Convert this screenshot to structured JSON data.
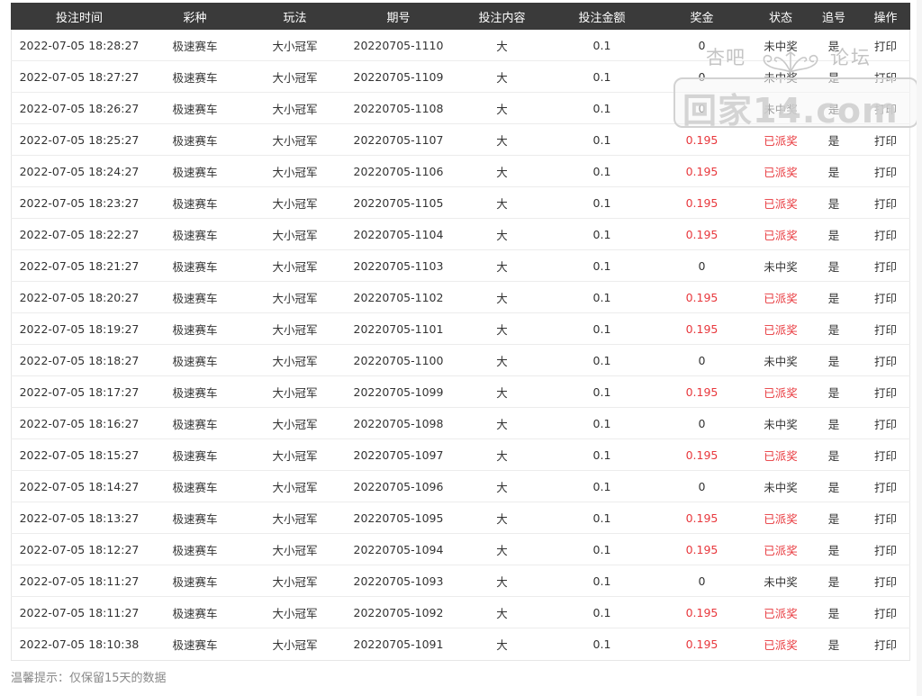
{
  "table": {
    "columns": [
      "投注时间",
      "彩种",
      "玩法",
      "期号",
      "投注内容",
      "投注金额",
      "奖金",
      "状态",
      "追号",
      "操作"
    ],
    "rows": [
      {
        "time": "2022-07-05 18:28:27",
        "lottery": "极速赛车",
        "play": "大小冠军",
        "period": "20220705-1110",
        "content": "大",
        "amount": "0.1",
        "prize": "0",
        "status": "未中奖",
        "chase": "是",
        "action": "打印",
        "won": false
      },
      {
        "time": "2022-07-05 18:27:27",
        "lottery": "极速赛车",
        "play": "大小冠军",
        "period": "20220705-1109",
        "content": "大",
        "amount": "0.1",
        "prize": "0",
        "status": "未中奖",
        "chase": "是",
        "action": "打印",
        "won": false
      },
      {
        "time": "2022-07-05 18:26:27",
        "lottery": "极速赛车",
        "play": "大小冠军",
        "period": "20220705-1108",
        "content": "大",
        "amount": "0.1",
        "prize": "0",
        "status": "未中奖",
        "chase": "是",
        "action": "打印",
        "won": false
      },
      {
        "time": "2022-07-05 18:25:27",
        "lottery": "极速赛车",
        "play": "大小冠军",
        "period": "20220705-1107",
        "content": "大",
        "amount": "0.1",
        "prize": "0.195",
        "status": "已派奖",
        "chase": "是",
        "action": "打印",
        "won": true
      },
      {
        "time": "2022-07-05 18:24:27",
        "lottery": "极速赛车",
        "play": "大小冠军",
        "period": "20220705-1106",
        "content": "大",
        "amount": "0.1",
        "prize": "0.195",
        "status": "已派奖",
        "chase": "是",
        "action": "打印",
        "won": true
      },
      {
        "time": "2022-07-05 18:23:27",
        "lottery": "极速赛车",
        "play": "大小冠军",
        "period": "20220705-1105",
        "content": "大",
        "amount": "0.1",
        "prize": "0.195",
        "status": "已派奖",
        "chase": "是",
        "action": "打印",
        "won": true
      },
      {
        "time": "2022-07-05 18:22:27",
        "lottery": "极速赛车",
        "play": "大小冠军",
        "period": "20220705-1104",
        "content": "大",
        "amount": "0.1",
        "prize": "0.195",
        "status": "已派奖",
        "chase": "是",
        "action": "打印",
        "won": true
      },
      {
        "time": "2022-07-05 18:21:27",
        "lottery": "极速赛车",
        "play": "大小冠军",
        "period": "20220705-1103",
        "content": "大",
        "amount": "0.1",
        "prize": "0",
        "status": "未中奖",
        "chase": "是",
        "action": "打印",
        "won": false
      },
      {
        "time": "2022-07-05 18:20:27",
        "lottery": "极速赛车",
        "play": "大小冠军",
        "period": "20220705-1102",
        "content": "大",
        "amount": "0.1",
        "prize": "0.195",
        "status": "已派奖",
        "chase": "是",
        "action": "打印",
        "won": true
      },
      {
        "time": "2022-07-05 18:19:27",
        "lottery": "极速赛车",
        "play": "大小冠军",
        "period": "20220705-1101",
        "content": "大",
        "amount": "0.1",
        "prize": "0.195",
        "status": "已派奖",
        "chase": "是",
        "action": "打印",
        "won": true
      },
      {
        "time": "2022-07-05 18:18:27",
        "lottery": "极速赛车",
        "play": "大小冠军",
        "period": "20220705-1100",
        "content": "大",
        "amount": "0.1",
        "prize": "0",
        "status": "未中奖",
        "chase": "是",
        "action": "打印",
        "won": false
      },
      {
        "time": "2022-07-05 18:17:27",
        "lottery": "极速赛车",
        "play": "大小冠军",
        "period": "20220705-1099",
        "content": "大",
        "amount": "0.1",
        "prize": "0.195",
        "status": "已派奖",
        "chase": "是",
        "action": "打印",
        "won": true
      },
      {
        "time": "2022-07-05 18:16:27",
        "lottery": "极速赛车",
        "play": "大小冠军",
        "period": "20220705-1098",
        "content": "大",
        "amount": "0.1",
        "prize": "0",
        "status": "未中奖",
        "chase": "是",
        "action": "打印",
        "won": false
      },
      {
        "time": "2022-07-05 18:15:27",
        "lottery": "极速赛车",
        "play": "大小冠军",
        "period": "20220705-1097",
        "content": "大",
        "amount": "0.1",
        "prize": "0.195",
        "status": "已派奖",
        "chase": "是",
        "action": "打印",
        "won": true
      },
      {
        "time": "2022-07-05 18:14:27",
        "lottery": "极速赛车",
        "play": "大小冠军",
        "period": "20220705-1096",
        "content": "大",
        "amount": "0.1",
        "prize": "0",
        "status": "未中奖",
        "chase": "是",
        "action": "打印",
        "won": false
      },
      {
        "time": "2022-07-05 18:13:27",
        "lottery": "极速赛车",
        "play": "大小冠军",
        "period": "20220705-1095",
        "content": "大",
        "amount": "0.1",
        "prize": "0.195",
        "status": "已派奖",
        "chase": "是",
        "action": "打印",
        "won": true
      },
      {
        "time": "2022-07-05 18:12:27",
        "lottery": "极速赛车",
        "play": "大小冠军",
        "period": "20220705-1094",
        "content": "大",
        "amount": "0.1",
        "prize": "0.195",
        "status": "已派奖",
        "chase": "是",
        "action": "打印",
        "won": true
      },
      {
        "time": "2022-07-05 18:11:27",
        "lottery": "极速赛车",
        "play": "大小冠军",
        "period": "20220705-1093",
        "content": "大",
        "amount": "0.1",
        "prize": "0",
        "status": "未中奖",
        "chase": "是",
        "action": "打印",
        "won": false
      },
      {
        "time": "2022-07-05 18:11:27",
        "lottery": "极速赛车",
        "play": "大小冠军",
        "period": "20220705-1092",
        "content": "大",
        "amount": "0.1",
        "prize": "0.195",
        "status": "已派奖",
        "chase": "是",
        "action": "打印",
        "won": true
      },
      {
        "time": "2022-07-05 18:10:38",
        "lottery": "极速赛车",
        "play": "大小冠军",
        "period": "20220705-1091",
        "content": "大",
        "amount": "0.1",
        "prize": "0.195",
        "status": "已派奖",
        "chase": "是",
        "action": "打印",
        "won": true
      }
    ]
  },
  "footer": {
    "tip": "温馨提示：仅保留15天的数据"
  },
  "watermark": {
    "top_left": "杏吧",
    "top_right": "论坛",
    "main": "回家14.com"
  },
  "colors": {
    "header_bg": "#3a3a3a",
    "win_text": "#e8383d",
    "text": "#333333",
    "tip": "#888888"
  }
}
